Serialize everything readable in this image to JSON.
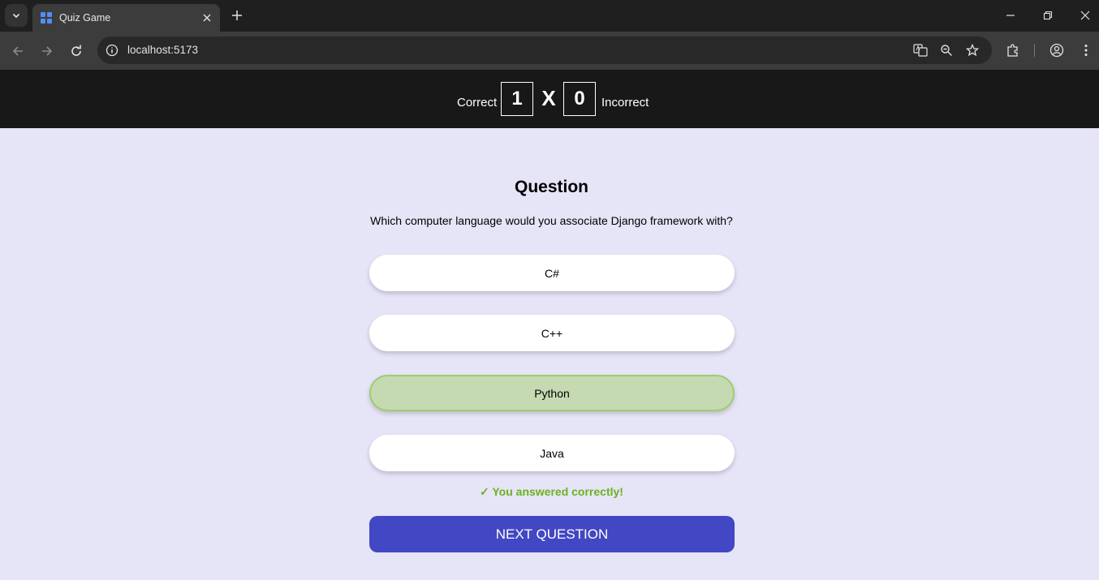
{
  "browser": {
    "tab_title": "Quiz Game",
    "url": "localhost:5173",
    "icons": [
      "tab-search-icon",
      "app-grid-icon",
      "close-icon",
      "plus-icon",
      "minimize-icon",
      "restore-icon",
      "back-icon",
      "forward-icon",
      "reload-icon",
      "site-info-icon",
      "translate-icon",
      "zoom-icon",
      "star-icon",
      "extensions-icon",
      "profile-icon",
      "more-icon"
    ]
  },
  "score": {
    "correct_label": "Correct",
    "correct_count": "1",
    "separator": "X",
    "incorrect_count": "0",
    "incorrect_label": "Incorrect"
  },
  "quiz": {
    "heading": "Question",
    "question": "Which computer language would you associate Django framework with?",
    "answers": [
      {
        "label": "C#",
        "state": "default"
      },
      {
        "label": "C++",
        "state": "default"
      },
      {
        "label": "Python",
        "state": "correct"
      },
      {
        "label": "Java",
        "state": "default"
      }
    ],
    "feedback": "✓ You answered correctly!",
    "next_button": "NEXT QUESTION"
  },
  "colors": {
    "page_background": "#e6e4f7",
    "score_bar": "#181818",
    "correct_answer_fill": "#c5dab2",
    "correct_answer_border": "#9dcf6a",
    "feedback_text": "#6ab31e",
    "next_button": "#4247c3"
  }
}
